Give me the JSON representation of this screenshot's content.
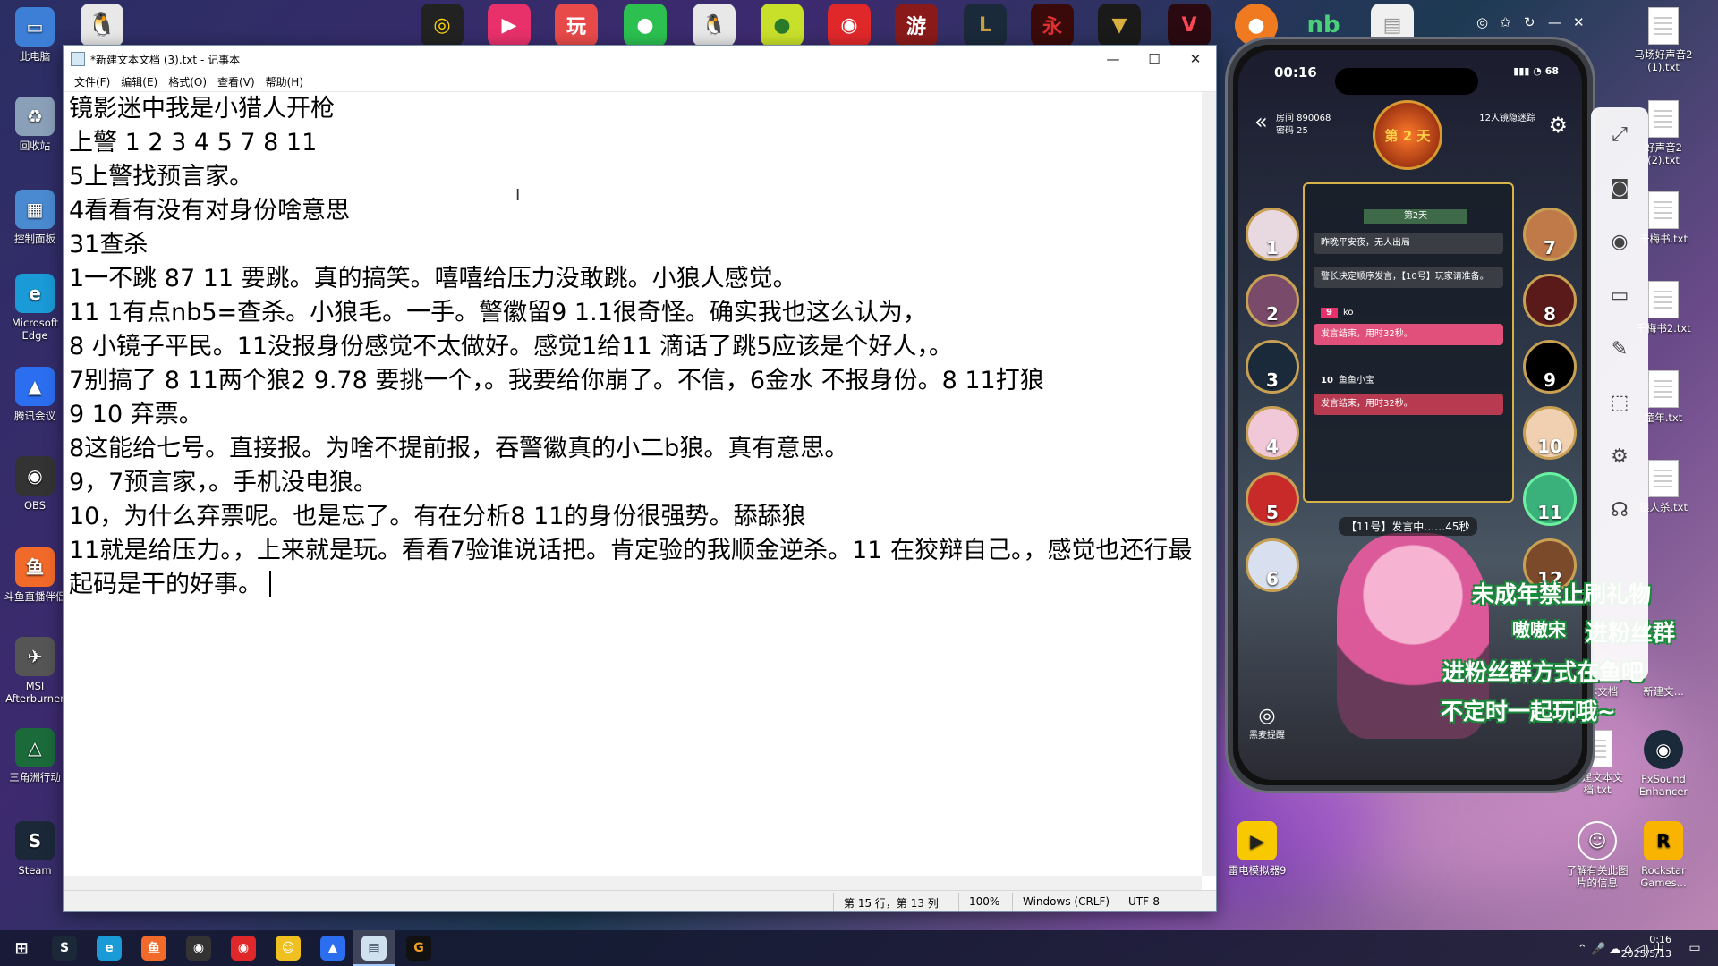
{
  "notepad": {
    "title": "*新建文本文档 (3).txt - 记事本",
    "menu": [
      "文件(F)",
      "编辑(E)",
      "格式(O)",
      "查看(V)",
      "帮助(H)"
    ],
    "content": "镜影迷中我是小猎人开枪\n上警 1 2 3 4 5 7 8 11\n5上警找预言家。\n4看看有没有对身份啥意思\n31查杀\n1一不跳 87 11 要跳。真的搞笑。嘻嘻给压力没敢跳。小狼人感觉。\n11 1有点nb5=查杀。小狼毛。一手。警徽留9 1.1很奇怪。确实我也这么认为，\n8 小镜子平民。11没报身份感觉不太做好。感觉1给11 滴话了跳5应该是个好人，。\n7别搞了 8 11两个狼2 9.78 要挑一个，。我要给你崩了。不信，6金水 不报身份。8 11打狼\n9 10 弃票。\n8这能给七号。直接报。为啥不提前报，吞警徽真的小二b狼。真有意思。\n9，7预言家，。手机没电狼。\n10，为什么弃票呢。也是忘了。有在分析8 11的身份很强势。舔舔狼\n11就是给压力。，上来就是玩。看看7验谁说话把。肯定验的我顺金逆杀。11 在狡辩自己。，感觉也还行最起码是干的好事。",
    "status": {
      "position": "第 15 行，第 13 列",
      "zoom": "100%",
      "line_ending": "Windows (CRLF)",
      "encoding": "UTF-8"
    }
  },
  "desktop_left": [
    {
      "label": "此电脑",
      "icon": "computer-icon",
      "color": "#3d7fd6"
    },
    {
      "label": "回收站",
      "icon": "recycle-bin-icon",
      "color": "#8aa0b8"
    },
    {
      "label": "控制面板",
      "icon": "control-panel-icon",
      "color": "#4a8ad0"
    },
    {
      "label": "Microsoft Edge",
      "icon": "edge-icon",
      "color": "#1a9ad6"
    },
    {
      "label": "腾讯会议",
      "icon": "tencent-meeting-icon",
      "color": "#2b6ff0"
    },
    {
      "label": "OBS",
      "icon": "obs-icon",
      "color": "#333"
    },
    {
      "label": "斗鱼直播伴侣",
      "icon": "douyu-icon",
      "color": "#f26a2a"
    },
    {
      "label": "MSI Afterburner",
      "icon": "msi-icon",
      "color": "#555"
    },
    {
      "label": "三角洲行动",
      "icon": "delta-force-icon",
      "color": "#1a6a3a"
    },
    {
      "label": "Steam",
      "icon": "steam-icon",
      "color": "#1b2838"
    }
  ],
  "desktop_right": [
    {
      "label": "马场好声音2 (1).txt"
    },
    {
      "label": "好声音2 (2).txt"
    },
    {
      "label": "千梅书.txt"
    },
    {
      "label": "千梅书2.txt"
    },
    {
      "label": "童年.txt"
    },
    {
      "label": "狼人杀.txt"
    },
    {
      "label": "本文档"
    },
    {
      "label": "新建文..."
    },
    {
      "label": "新建文本文档.txt"
    },
    {
      "label": "FxSound Enhancer"
    },
    {
      "label": "了解有关此图片的信息"
    },
    {
      "label": "Rockstar Games..."
    },
    {
      "label": "雷电模拟器9"
    }
  ],
  "phone": {
    "time": "00:16",
    "battery": "68",
    "room_number": "房间 890068",
    "room_password": "密码 25",
    "day_badge": "第 2 天",
    "mode": "12人镜隐迷踪",
    "day_tag": "第2天",
    "msg_night": "昨晚平安夜，无人出局",
    "msg_order": "警长决定顺序发言，【10号】玩家请准备。",
    "msg_9_name": "ko",
    "msg_9_text": "发言结束，用时32秒。",
    "msg_10_name": "鱼鱼小宝",
    "msg_10_text": "发言结束，用时32秒。",
    "speaking": "【11号】发言中……45秒",
    "seats_left": [
      "1",
      "2",
      "3",
      "4",
      "5",
      "6"
    ],
    "seats_right": [
      "7",
      "8",
      "9",
      "10",
      "11",
      "12"
    ],
    "black_wheat": "黑麦提醒"
  },
  "stream_overlay": {
    "line1": "未成年禁止刷礼物",
    "line2a": "嗷嗷宋",
    "line2b": "进粉丝群",
    "line3": "进粉丝群方式在鱼吧",
    "line4": "不定时一起玩哦~"
  },
  "taskbar": {
    "clock_time": "0:16",
    "clock_date": "2025/5/13",
    "ime": "中"
  }
}
